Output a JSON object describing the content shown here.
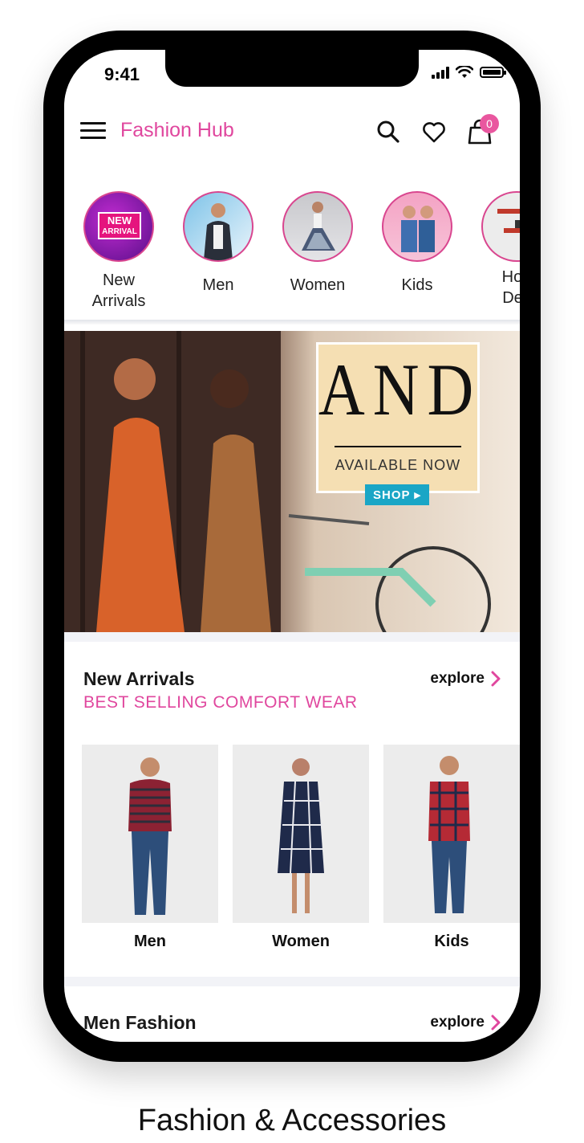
{
  "status_bar": {
    "time": "9:41"
  },
  "app_bar": {
    "title": "Fashion Hub",
    "cart_count": "0"
  },
  "categories": [
    {
      "label_line1": "New",
      "label_line2": "Arrivals",
      "badge_line1": "NEW",
      "badge_line2": "ARRIVAL"
    },
    {
      "label_line1": "Men",
      "label_line2": ""
    },
    {
      "label_line1": "Women",
      "label_line2": ""
    },
    {
      "label_line1": "Kids",
      "label_line2": ""
    },
    {
      "label_line1": "Hon",
      "label_line2": "Dec"
    }
  ],
  "banner": {
    "brand": "AND",
    "tagline": "AVAILABLE NOW",
    "cta": "SHOP ▸"
  },
  "new_arrivals": {
    "title": "New Arrivals",
    "subtitle": "BEST SELLING COMFORT WEAR",
    "explore": "explore",
    "items": [
      {
        "label": "Men"
      },
      {
        "label": "Women"
      },
      {
        "label": "Kids"
      }
    ]
  },
  "men_fashion": {
    "title": "Men Fashion",
    "explore": "explore"
  },
  "caption": "Fashion & Accessories",
  "colors": {
    "accent": "#e0479e",
    "badge": "#e9579f",
    "cta": "#1aa6c6"
  }
}
